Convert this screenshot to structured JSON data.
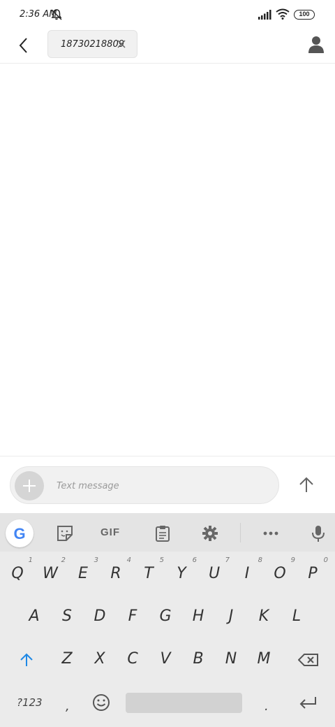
{
  "status_bar": {
    "time": "2:36 AM",
    "battery": "100"
  },
  "header": {
    "recipient": "18730218809"
  },
  "compose": {
    "placeholder": "Text message"
  },
  "keyboard": {
    "toolbar": {
      "google": "G",
      "gif": "GIF"
    },
    "row1": [
      {
        "key": "Q",
        "hint": "1"
      },
      {
        "key": "W",
        "hint": "2"
      },
      {
        "key": "E",
        "hint": "3"
      },
      {
        "key": "R",
        "hint": "4"
      },
      {
        "key": "T",
        "hint": "5"
      },
      {
        "key": "Y",
        "hint": "6"
      },
      {
        "key": "U",
        "hint": "7"
      },
      {
        "key": "I",
        "hint": "8"
      },
      {
        "key": "O",
        "hint": "9"
      },
      {
        "key": "P",
        "hint": "0"
      }
    ],
    "row2": [
      "A",
      "S",
      "D",
      "F",
      "G",
      "H",
      "J",
      "K",
      "L"
    ],
    "row3": [
      "Z",
      "X",
      "C",
      "V",
      "B",
      "N",
      "M"
    ],
    "bottom": {
      "symbols": "?123",
      "comma": ",",
      "period": "."
    }
  },
  "colors": {
    "accent": "#1e88e5",
    "keyboard_bg": "#ebebeb"
  }
}
